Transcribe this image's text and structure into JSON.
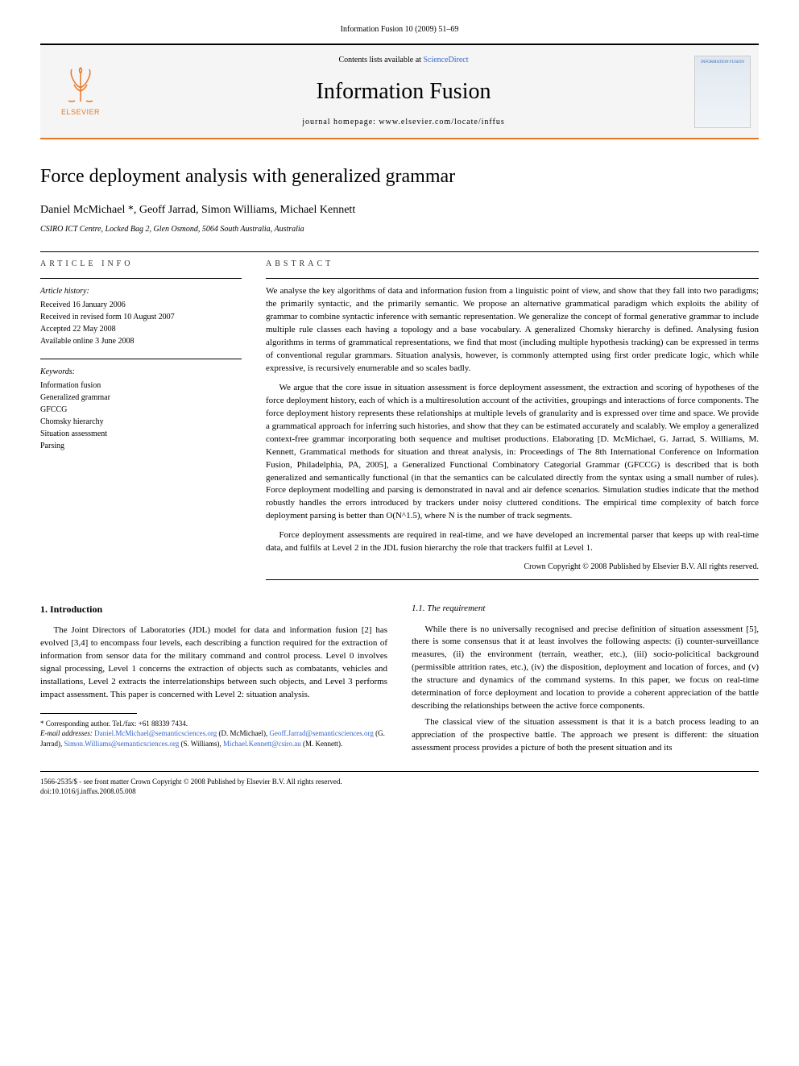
{
  "header": {
    "citation": "Information Fusion 10 (2009) 51–69"
  },
  "masthead": {
    "contents_prefix": "Contents lists available at ",
    "contents_link": "ScienceDirect",
    "journal": "Information Fusion",
    "homepage": "journal homepage: www.elsevier.com/locate/inffus",
    "publisher": "ELSEVIER",
    "cover_label": "INFORMATION FUSION"
  },
  "article": {
    "title": "Force deployment analysis with generalized grammar",
    "authors": "Daniel McMichael *, Geoff Jarrad, Simon Williams, Michael Kennett",
    "affiliation": "CSIRO ICT Centre, Locked Bag 2, Glen Osmond, 5064 South Australia, Australia"
  },
  "info": {
    "label": "ARTICLE INFO",
    "history_head": "Article history:",
    "history": [
      "Received 16 January 2006",
      "Received in revised form 10 August 2007",
      "Accepted 22 May 2008",
      "Available online 3 June 2008"
    ],
    "keywords_head": "Keywords:",
    "keywords": [
      "Information fusion",
      "Generalized grammar",
      "GFCCG",
      "Chomsky hierarchy",
      "Situation assessment",
      "Parsing"
    ]
  },
  "abstract": {
    "label": "ABSTRACT",
    "p1": "We analyse the key algorithms of data and information fusion from a linguistic point of view, and show that they fall into two paradigms; the primarily syntactic, and the primarily semantic. We propose an alternative grammatical paradigm which exploits the ability of grammar to combine syntactic inference with semantic representation. We generalize the concept of formal generative grammar to include multiple rule classes each having a topology and a base vocabulary. A generalized Chomsky hierarchy is defined. Analysing fusion algorithms in terms of grammatical representations, we find that most (including multiple hypothesis tracking) can be expressed in terms of conventional regular grammars. Situation analysis, however, is commonly attempted using first order predicate logic, which while expressive, is recursively enumerable and so scales badly.",
    "p2": "We argue that the core issue in situation assessment is force deployment assessment, the extraction and scoring of hypotheses of the force deployment history, each of which is a multiresolution account of the activities, groupings and interactions of force components. The force deployment history represents these relationships at multiple levels of granularity and is expressed over time and space. We provide a grammatical approach for inferring such histories, and show that they can be estimated accurately and scalably. We employ a generalized context-free grammar incorporating both sequence and multiset productions. Elaborating [D. McMichael, G. Jarrad, S. Williams, M. Kennett, Grammatical methods for situation and threat analysis, in: Proceedings of The 8th International Conference on Information Fusion, Philadelphia, PA, 2005], a Generalized Functional Combinatory Categorial Grammar (GFCCG) is described that is both generalized and semantically functional (in that the semantics can be calculated directly from the syntax using a small number of rules). Force deployment modelling and parsing is demonstrated in naval and air defence scenarios. Simulation studies indicate that the method robustly handles the errors introduced by trackers under noisy cluttered conditions. The empirical time complexity of batch force deployment parsing is better than O(N^1.5), where N is the number of track segments.",
    "p3": "Force deployment assessments are required in real-time, and we have developed an incremental parser that keeps up with real-time data, and fulfils at Level 2 in the JDL fusion hierarchy the role that trackers fulfil at Level 1.",
    "copyright": "Crown Copyright © 2008 Published by Elsevier B.V. All rights reserved."
  },
  "body": {
    "s1_title": "1. Introduction",
    "s1_p1": "The Joint Directors of Laboratories (JDL) model for data and information fusion [2] has evolved [3,4] to encompass four levels, each describing a function required for the extraction of information from sensor data for the military command and control process. Level 0 involves signal processing, Level 1 concerns the extraction of objects such as combatants, vehicles and installations, Level 2 extracts the interrelationships between such objects, and Level 3 performs impact assessment. This paper is concerned with Level 2: situation analysis.",
    "s11_title": "1.1. The requirement",
    "s11_p1": "While there is no universally recognised and precise definition of situation assessment [5], there is some consensus that it at least involves the following aspects: (i) counter-surveillance measures, (ii) the environment (terrain, weather, etc.), (iii) socio-policitical background (permissible attrition rates, etc.), (iv) the disposition, deployment and location of forces, and (v) the structure and dynamics of the command systems. In this paper, we focus on real-time determination of force deployment and location to provide a coherent appreciation of the battle describing the relationships between the active force components.",
    "s11_p2": "The classical view of the situation assessment is that it is a batch process leading to an appreciation of the prospective battle. The approach we present is different: the situation assessment process provides a picture of both the present situation and its"
  },
  "footnotes": {
    "corr": "* Corresponding author. Tel./fax: +61 88339 7434.",
    "email_label": "E-mail addresses:",
    "emails": [
      {
        "addr": "Daniel.McMichael@semanticsciences.org",
        "who": "(D. McMichael)"
      },
      {
        "addr": "Geoff.Jarrad@semanticsciences.org",
        "who": "(G. Jarrad)"
      },
      {
        "addr": "Simon.Williams@semanticsciences.org",
        "who": "(S. Williams)"
      },
      {
        "addr": "Michael.Kennett@csiro.au",
        "who": "(M. Kennett)"
      }
    ]
  },
  "bottom": {
    "issn": "1566-2535/$ - see front matter Crown Copyright © 2008 Published by Elsevier B.V. All rights reserved.",
    "doi": "doi:10.1016/j.inffus.2008.05.008"
  }
}
